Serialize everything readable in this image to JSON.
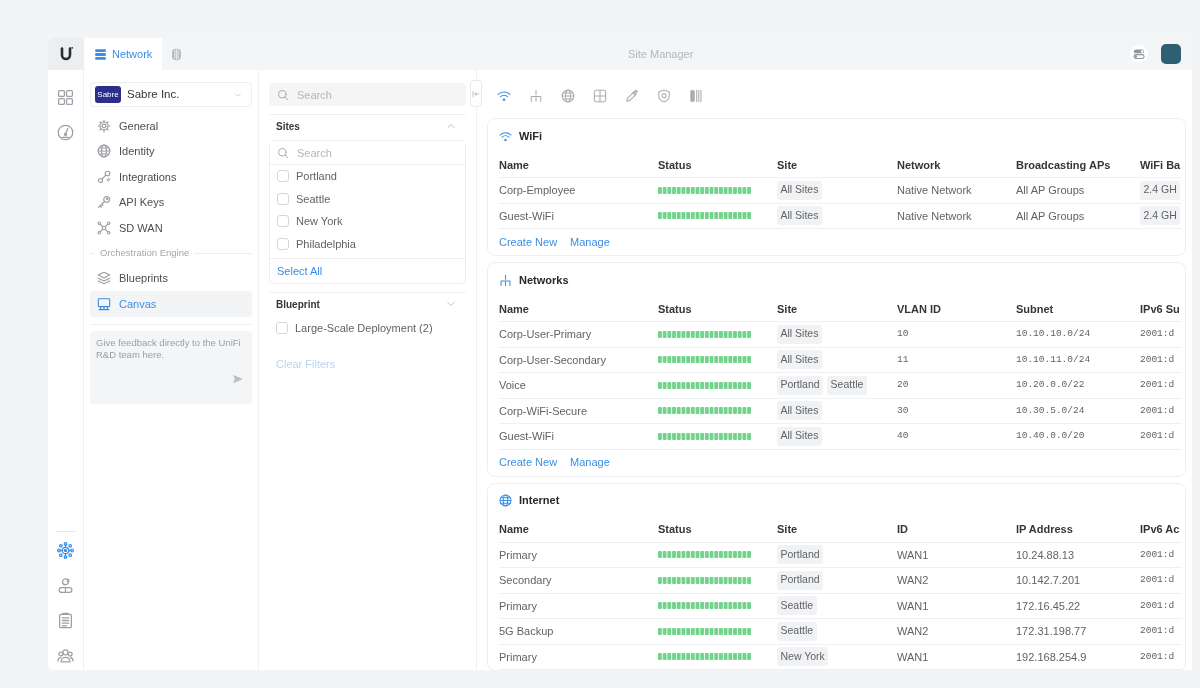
{
  "top_bar": {
    "tabs": [
      {
        "label": "Network",
        "selected": true
      },
      {
        "selected": false
      }
    ],
    "title": "Site Manager"
  },
  "rail": {
    "top_items": [
      {
        "selected": false
      },
      {
        "selected": false
      }
    ],
    "bottom_items": [
      {
        "selected": true
      },
      {
        "selected": false
      },
      {
        "selected": false
      },
      {
        "selected": false
      }
    ]
  },
  "sidebar": {
    "org": {
      "logo": "Sabre",
      "name": "Sabre Inc."
    },
    "items": [
      {
        "label": "General",
        "selected": false
      },
      {
        "label": "Identity",
        "selected": false
      },
      {
        "label": "Integrations",
        "selected": false
      },
      {
        "label": "API Keys",
        "selected": false
      },
      {
        "label": "SD WAN",
        "selected": false
      }
    ],
    "section": {
      "title": "Orchestration Engine",
      "items": [
        {
          "label": "Blueprints",
          "selected": false
        },
        {
          "label": "Canvas",
          "selected": true
        }
      ]
    },
    "feedback": {
      "placeholder": "Give feedback directly to the UniFi R&D team here."
    }
  },
  "filters": {
    "search": {
      "placeholder": "Search"
    },
    "groups": [
      {
        "title": "Sites",
        "expanded": true,
        "search": {
          "placeholder": "Search"
        },
        "options": [
          {
            "label": "Portland",
            "checked": false
          },
          {
            "label": "Seattle",
            "checked": false
          },
          {
            "label": "New York",
            "checked": false
          },
          {
            "label": "Philadelphia",
            "checked": false
          }
        ],
        "action": "Select All"
      },
      {
        "title": "Blueprint",
        "expanded": false,
        "options": [
          {
            "label": "Large-Scale Deployment (2)",
            "checked": false
          }
        ]
      }
    ],
    "clear": {
      "label": "Clear Filters",
      "disabled": true
    }
  },
  "main": {
    "view_tabs": [
      {
        "selected": true
      },
      {
        "selected": false
      },
      {
        "selected": false
      },
      {
        "selected": false
      },
      {
        "selected": false
      },
      {
        "selected": false
      },
      {
        "selected": false
      }
    ],
    "sections": [
      {
        "title": "WiFi",
        "columns": [
          {
            "label": "Name",
            "kind": "name"
          },
          {
            "label": "Status",
            "kind": "status"
          },
          {
            "label": "Site",
            "kind": "tags"
          },
          {
            "label": "Network",
            "kind": "text"
          },
          {
            "label": "Broadcasting APs",
            "kind": "text"
          },
          {
            "label": "WiFi Ba",
            "kind": "tags"
          }
        ],
        "rows": [
          [
            "Corp-Employee",
            {
              "online": true
            },
            [
              "All Sites"
            ],
            "Native Network",
            "All AP Groups",
            [
              "2.4 GH"
            ]
          ],
          [
            "Guest-WiFi",
            {
              "online": true
            },
            [
              "All Sites"
            ],
            "Native Network",
            "All AP Groups",
            [
              "2.4 GH"
            ]
          ]
        ],
        "actions": [
          "Create New",
          "Manage"
        ]
      },
      {
        "title": "Networks",
        "columns": [
          {
            "label": "Name",
            "kind": "name"
          },
          {
            "label": "Status",
            "kind": "status"
          },
          {
            "label": "Site",
            "kind": "tags"
          },
          {
            "label": "VLAN ID",
            "kind": "code"
          },
          {
            "label": "Subnet",
            "kind": "code"
          },
          {
            "label": "IPv6 Su",
            "kind": "code"
          }
        ],
        "rows": [
          [
            "Corp-User-Primary",
            {
              "online": true
            },
            [
              "All Sites"
            ],
            "10",
            "10.10.10.0/24",
            "2001:d"
          ],
          [
            "Corp-User-Secondary",
            {
              "online": true
            },
            [
              "All Sites"
            ],
            "11",
            "10.10.11.0/24",
            "2001:d"
          ],
          [
            "Voice",
            {
              "online": true
            },
            [
              "Portland",
              "Seattle"
            ],
            "20",
            "10.20.0.0/22",
            "2001:d"
          ],
          [
            "Corp-WiFi-Secure",
            {
              "online": true
            },
            [
              "All Sites"
            ],
            "30",
            "10.30.5.0/24",
            "2001:d"
          ],
          [
            "Guest-WiFi",
            {
              "online": true
            },
            [
              "All Sites"
            ],
            "40",
            "10.40.0.0/20",
            "2001:d"
          ]
        ],
        "actions": [
          "Create New",
          "Manage"
        ]
      },
      {
        "title": "Internet",
        "columns": [
          {
            "label": "Name",
            "kind": "name"
          },
          {
            "label": "Status",
            "kind": "status"
          },
          {
            "label": "Site",
            "kind": "tags"
          },
          {
            "label": "ID",
            "kind": "text"
          },
          {
            "label": "IP Address",
            "kind": "text"
          },
          {
            "label": "IPv6 Ac",
            "kind": "code"
          }
        ],
        "rows": [
          [
            "Primary",
            {
              "online": true
            },
            [
              "Portland"
            ],
            "WAN1",
            "10.24.88.13",
            "2001:d"
          ],
          [
            "Secondary",
            {
              "online": true
            },
            [
              "Portland"
            ],
            "WAN2",
            "10.142.7.201",
            "2001:d"
          ],
          [
            "Primary",
            {
              "online": true
            },
            [
              "Seattle"
            ],
            "WAN1",
            "172.16.45.22",
            "2001:d"
          ],
          [
            "5G Backup",
            {
              "online": true
            },
            [
              "Seattle"
            ],
            "WAN2",
            "172.31.198.77",
            "2001:d"
          ],
          [
            "Primary",
            {
              "online": true
            },
            [
              "New York"
            ],
            "WAN1",
            "192.168.254.9",
            "2001:d"
          ]
        ]
      }
    ]
  }
}
